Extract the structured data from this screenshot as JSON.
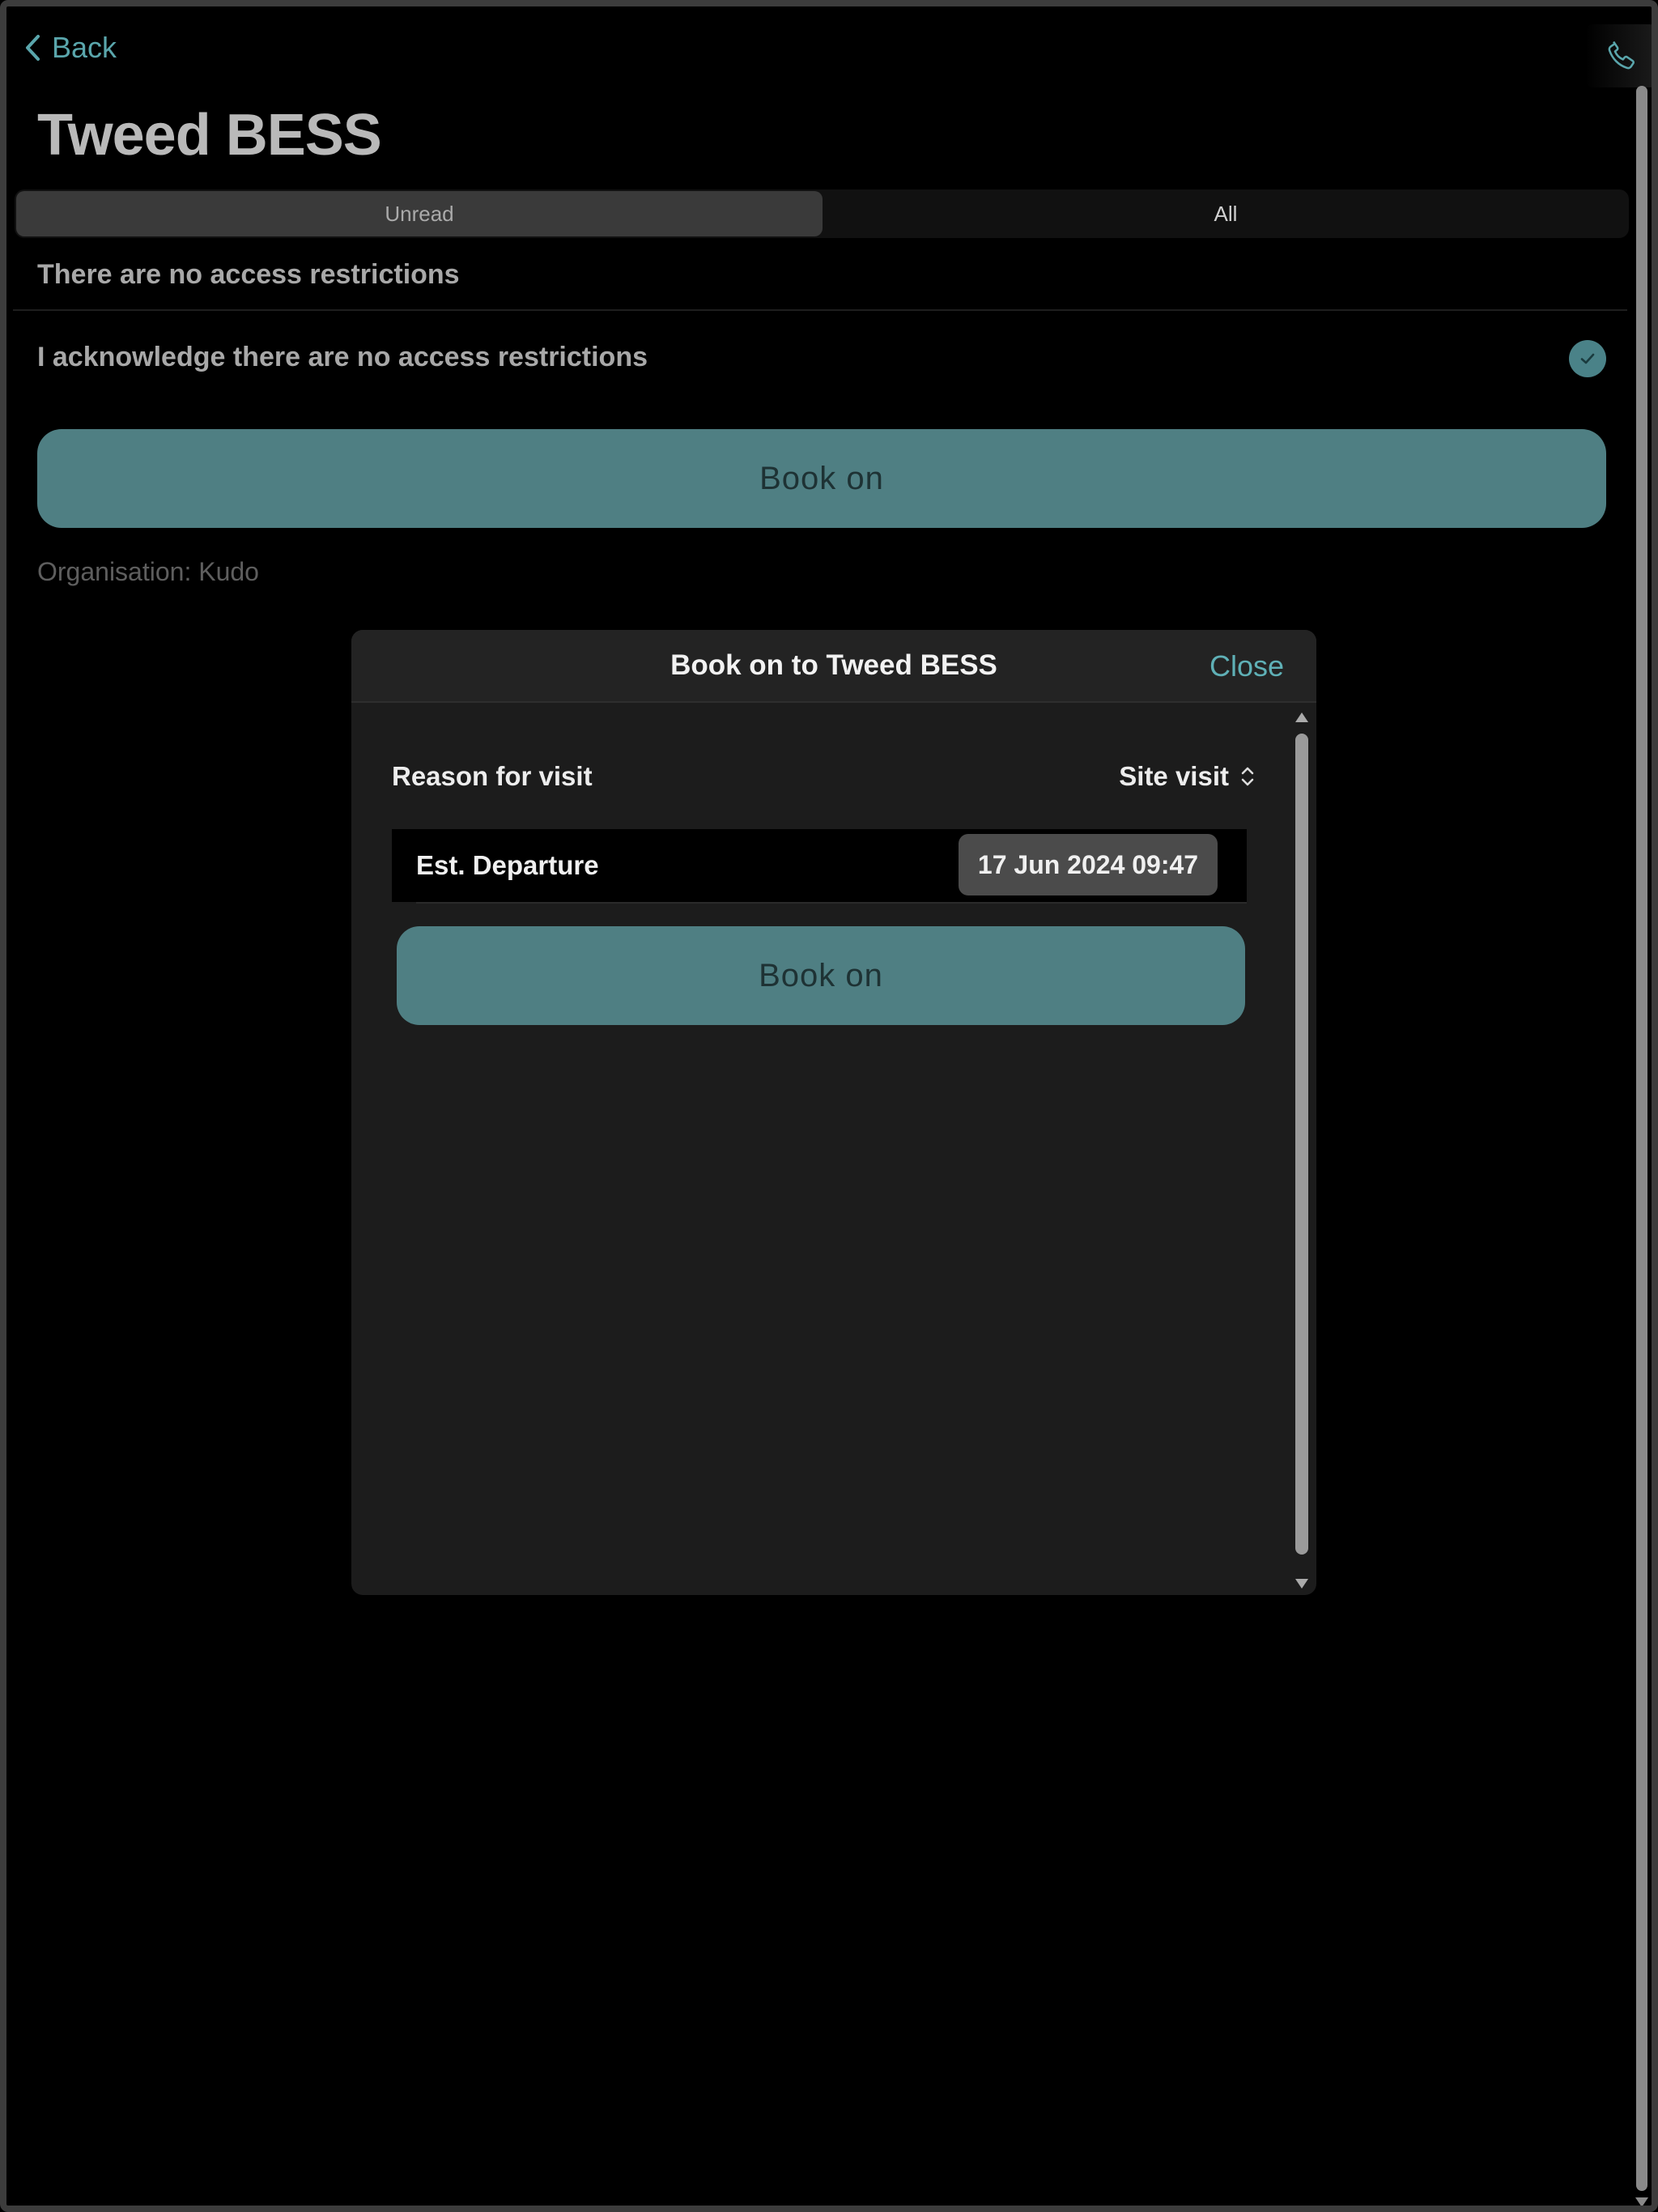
{
  "nav": {
    "back_label": "Back",
    "back_icon": "chevron-left-icon",
    "phone_icon": "phone-icon"
  },
  "page": {
    "title": "Tweed BESS",
    "tabs": [
      {
        "label": "Unread",
        "active": true
      },
      {
        "label": "All",
        "active": false
      }
    ],
    "restriction_text": "There are no access restrictions",
    "acknowledge_text": "I acknowledge there are no access restrictions",
    "acknowledged": true,
    "book_on_label": "Book on",
    "organisation": "Organisation: Kudo"
  },
  "modal": {
    "title": "Book on to Tweed BESS",
    "close_label": "Close",
    "reason_label": "Reason for visit",
    "reason_value": "Site visit",
    "departure_label": "Est. Departure",
    "departure_value": "17 Jun 2024 09:47",
    "book_on_label": "Book on"
  },
  "colors": {
    "accent": "#5aa6ac",
    "button_fill": "#4f7f83",
    "background": "#000000",
    "modal_bg": "#1c1c1c"
  }
}
